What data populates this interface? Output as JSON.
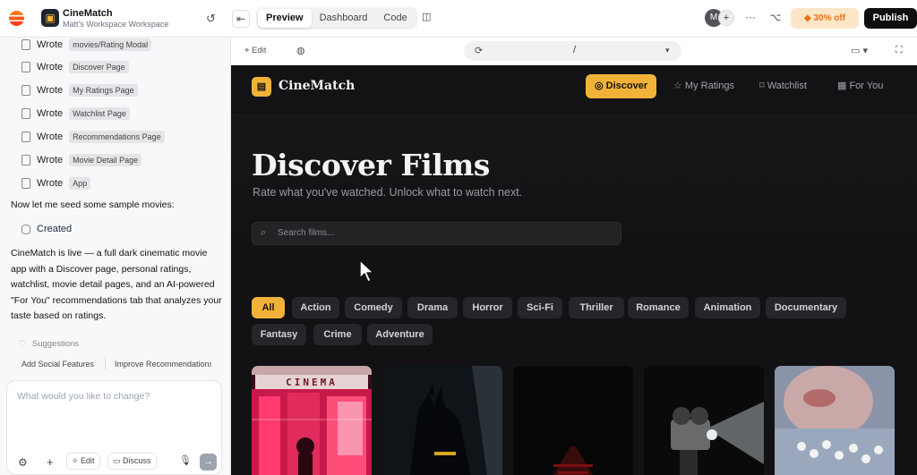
{
  "topbar": {
    "app_name": "CineMatch",
    "workspace": "Matt's Workspace Workspace",
    "tabs": [
      "Preview",
      "Dashboard",
      "Code"
    ],
    "active_tab": "Preview",
    "avatar_initial": "M",
    "more_label": "···",
    "promo_label": "30% off",
    "publish_label": "Publish"
  },
  "sidebar": {
    "writes": [
      {
        "verb": "Wrote",
        "file": "movies/Rating Modal"
      },
      {
        "verb": "Wrote",
        "file": "Discover Page"
      },
      {
        "verb": "Wrote",
        "file": "My Ratings Page"
      },
      {
        "verb": "Wrote",
        "file": "Watchlist Page"
      },
      {
        "verb": "Wrote",
        "file": "Recommendations Page"
      },
      {
        "verb": "Wrote",
        "file": "Movie Detail Page"
      },
      {
        "verb": "Wrote",
        "file": "App"
      }
    ],
    "seed_note": "Now let me seed some sample movies:",
    "created_label": "Created",
    "summary": "CineMatch is live — a full dark cinematic movie app with a Discover page, personal ratings, watchlist, movie detail pages, and an AI-powered \"For You\" recommendations tab that analyzes your taste based on ratings.",
    "suggestions_label": "Suggestions",
    "suggestions": [
      "Add Social Features",
      "Improve Recommendations"
    ],
    "input_placeholder": "What would you like to change?",
    "edit_label": "Edit",
    "discuss_label": "Discuss"
  },
  "subbar": {
    "edit_label": "Edit",
    "url_path": "/"
  },
  "preview": {
    "brand": "CineMatch",
    "nav": [
      {
        "label": "Discover",
        "icon": "compass-icon",
        "active": true
      },
      {
        "label": "My Ratings",
        "icon": "star-icon",
        "active": false
      },
      {
        "label": "Watchlist",
        "icon": "bookmark-icon",
        "active": false
      },
      {
        "label": "For You",
        "icon": "film-icon",
        "active": false
      }
    ],
    "title": "Discover Films",
    "subtitle": "Rate what you've watched. Unlock what to watch next.",
    "search_placeholder": "Search films...",
    "genres": [
      "All",
      "Action",
      "Comedy",
      "Drama",
      "Horror",
      "Sci-Fi",
      "Thriller",
      "Romance",
      "Animation",
      "Documentary",
      "Fantasy",
      "Crime",
      "Adventure"
    ],
    "active_genre": "All",
    "poster_cinema_sign": "CINEMA",
    "accent_color": "#f2b23a"
  }
}
